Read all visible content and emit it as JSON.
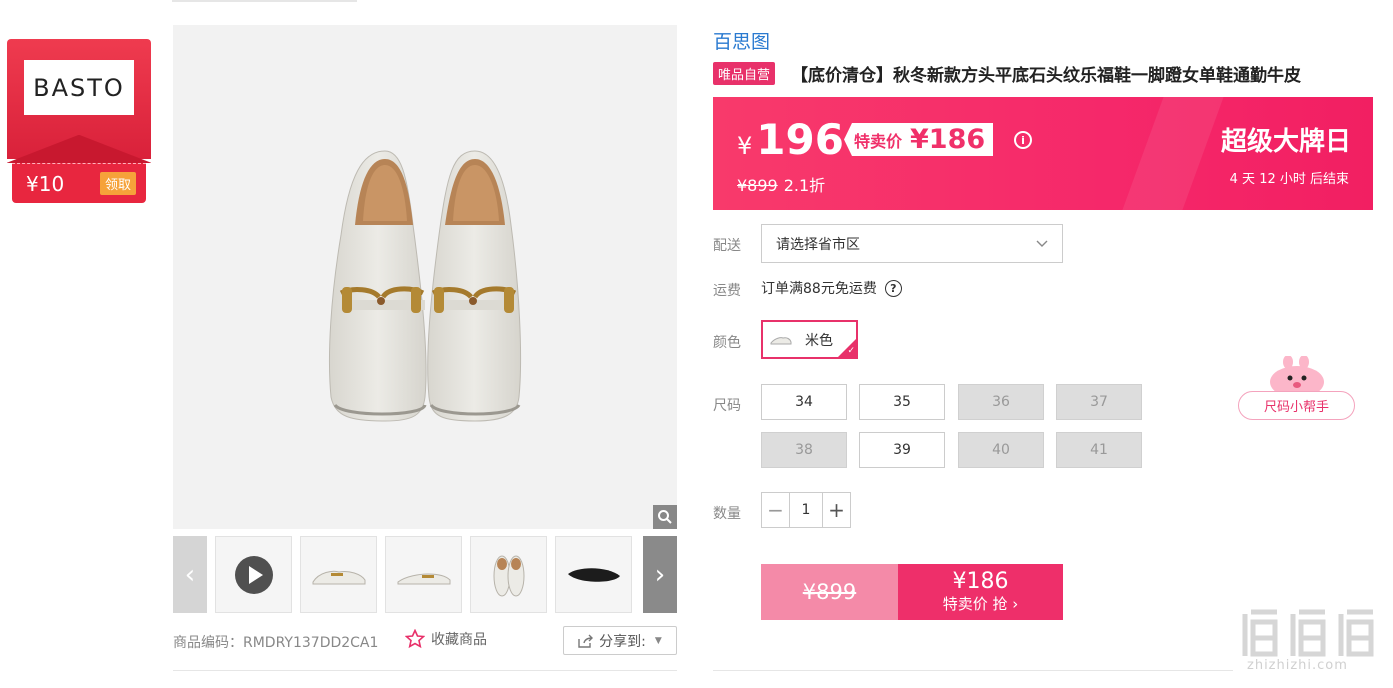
{
  "coupon": {
    "brand_logo": "BASTO",
    "amount": "¥10",
    "action": "领取"
  },
  "product": {
    "brand": "百思图",
    "self_badge": "唯品自营",
    "title": "【底价清仓】秋冬新款方头平底石头纹乐福鞋一脚蹬女单鞋通勤牛皮",
    "sku": "商品编码：RMDRY137DD2CA1",
    "favorite_label": "收藏商品",
    "share_label": "分享到:"
  },
  "price": {
    "currency": "¥",
    "current": "196",
    "special_label": "特卖价",
    "special_price": "¥186",
    "original": "¥899",
    "discount": "2.1折",
    "promo_title": "超级大牌日",
    "countdown": "4 天 12 小时 后结束"
  },
  "delivery": {
    "label": "配送",
    "placeholder": "请选择省市区"
  },
  "shipping": {
    "label": "运费",
    "text": "订单满88元免运费",
    "help": "?"
  },
  "color": {
    "label": "颜色",
    "selected": "米色"
  },
  "sizes": {
    "label": "尺码",
    "items": [
      {
        "value": "34",
        "available": true
      },
      {
        "value": "35",
        "available": true
      },
      {
        "value": "36",
        "available": false
      },
      {
        "value": "37",
        "available": false
      },
      {
        "value": "38",
        "available": false
      },
      {
        "value": "39",
        "available": true
      },
      {
        "value": "40",
        "available": false
      },
      {
        "value": "41",
        "available": false
      }
    ]
  },
  "quantity": {
    "label": "数量",
    "value": "1",
    "minus": "−",
    "plus": "+"
  },
  "buy": {
    "original": "¥899",
    "price": "¥186",
    "label": "特卖价 抢 ›"
  },
  "size_helper": {
    "label": "尺码小帮手"
  },
  "watermark": {
    "text": "zhizhizhi.com"
  },
  "colors": {
    "accent": "#f0306a",
    "brand_link": "#2a7ad0"
  }
}
